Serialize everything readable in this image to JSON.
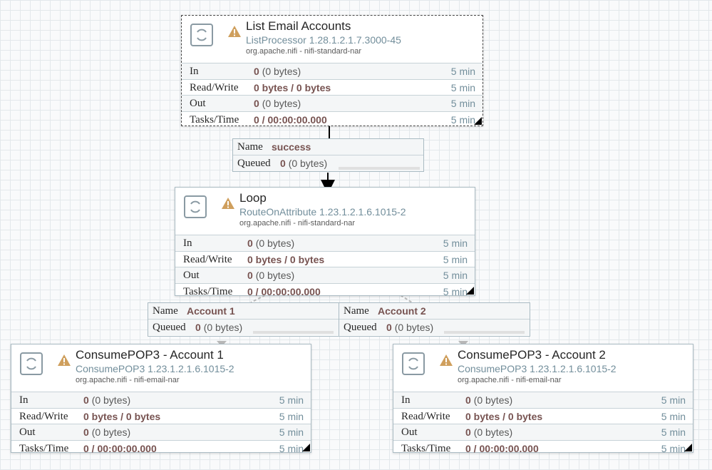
{
  "processors": [
    {
      "title": "List Email Accounts",
      "type": "ListProcessor 1.28.1.2.1.7.3000-45",
      "bundle": "org.apache.nifi - nifi-standard-nar",
      "has_warning": true,
      "stats": [
        {
          "label": "In",
          "value": "0",
          "detail": "(0 bytes)",
          "period": "5 min"
        },
        {
          "label": "Read/Write",
          "value": "0 bytes / 0 bytes",
          "detail": "",
          "period": "5 min"
        },
        {
          "label": "Out",
          "value": "0",
          "detail": "(0 bytes)",
          "period": "5 min"
        },
        {
          "label": "Tasks/Time",
          "value": "0 / 00:00:00.000",
          "detail": "",
          "period": "5 min"
        }
      ]
    },
    {
      "title": "Loop",
      "type": "RouteOnAttribute 1.23.1.2.1.6.1015-2",
      "bundle": "org.apache.nifi - nifi-standard-nar",
      "has_warning": true,
      "stats": [
        {
          "label": "In",
          "value": "0",
          "detail": "(0 bytes)",
          "period": "5 min"
        },
        {
          "label": "Read/Write",
          "value": "0 bytes / 0 bytes",
          "detail": "",
          "period": "5 min"
        },
        {
          "label": "Out",
          "value": "0",
          "detail": "(0 bytes)",
          "period": "5 min"
        },
        {
          "label": "Tasks/Time",
          "value": "0 / 00:00:00.000",
          "detail": "",
          "period": "5 min"
        }
      ]
    },
    {
      "title": "ConsumePOP3 - Account 1",
      "type": "ConsumePOP3 1.23.1.2.1.6.1015-2",
      "bundle": "org.apache.nifi - nifi-email-nar",
      "has_warning": true,
      "stats": [
        {
          "label": "In",
          "value": "0",
          "detail": "(0 bytes)",
          "period": "5 min"
        },
        {
          "label": "Read/Write",
          "value": "0 bytes / 0 bytes",
          "detail": "",
          "period": "5 min"
        },
        {
          "label": "Out",
          "value": "0",
          "detail": "(0 bytes)",
          "period": "5 min"
        },
        {
          "label": "Tasks/Time",
          "value": "0 / 00:00:00.000",
          "detail": "",
          "period": "5 min"
        }
      ]
    },
    {
      "title": "ConsumePOP3 - Account 2",
      "type": "ConsumePOP3 1.23.1.2.1.6.1015-2",
      "bundle": "org.apache.nifi - nifi-email-nar",
      "has_warning": true,
      "stats": [
        {
          "label": "In",
          "value": "0",
          "detail": "(0 bytes)",
          "period": "5 min"
        },
        {
          "label": "Read/Write",
          "value": "0 bytes / 0 bytes",
          "detail": "",
          "period": "5 min"
        },
        {
          "label": "Out",
          "value": "0",
          "detail": "(0 bytes)",
          "period": "5 min"
        },
        {
          "label": "Tasks/Time",
          "value": "0 / 00:00:00.000",
          "detail": "",
          "period": "5 min"
        }
      ]
    }
  ],
  "connections": [
    {
      "name_label": "Name",
      "name": "success",
      "queued_label": "Queued",
      "queued_count": "0",
      "queued_size": "(0 bytes)"
    },
    {
      "name_label": "Name",
      "name": "Account 1",
      "queued_label": "Queued",
      "queued_count": "0",
      "queued_size": "(0 bytes)"
    },
    {
      "name_label": "Name",
      "name": "Account 2",
      "queued_label": "Queued",
      "queued_count": "0",
      "queued_size": "(0 bytes)"
    }
  ],
  "colors": {
    "canvas": "#f9fafb",
    "grid": "#e3e8eb",
    "value_accent": "#775351",
    "type_text": "#728e9b",
    "warning": "#cf9f5d"
  }
}
